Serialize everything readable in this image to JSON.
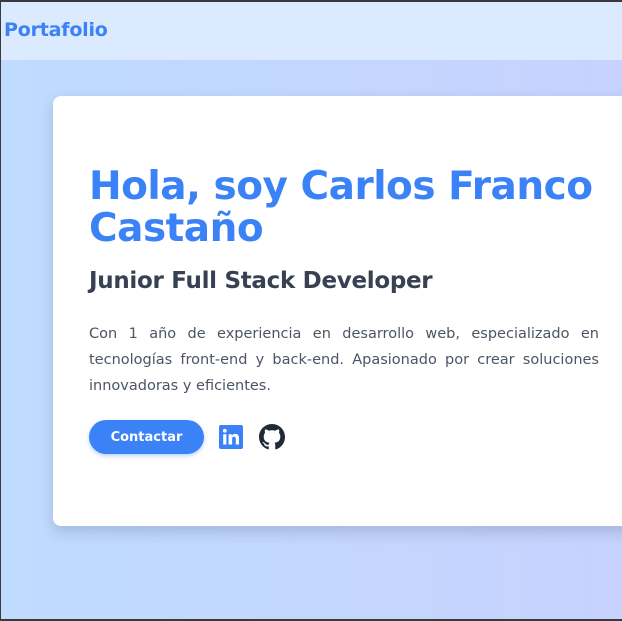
{
  "nav": {
    "brand": "Portafolio"
  },
  "hero": {
    "title": "Hola, soy Carlos Franco Castaño",
    "subtitle": "Junior Full Stack Developer",
    "description": "Con 1 año de experiencia en desarrollo web, especializado en tecnologías front-end y back-end. Apasionado por crear soluciones innovadoras y eficientes.",
    "contact_label": "Contactar"
  },
  "social": [
    {
      "icon": "linkedin-icon",
      "color": "#3b82f6"
    },
    {
      "icon": "github-icon",
      "color": "#1f2937"
    }
  ],
  "colors": {
    "accent": "#3b82f6",
    "heading": "#374151",
    "text": "#4b5563",
    "nav_bg": "#dbeafe",
    "page_bg_start": "#bfdbfe",
    "page_bg_end": "#c7d2fe"
  }
}
